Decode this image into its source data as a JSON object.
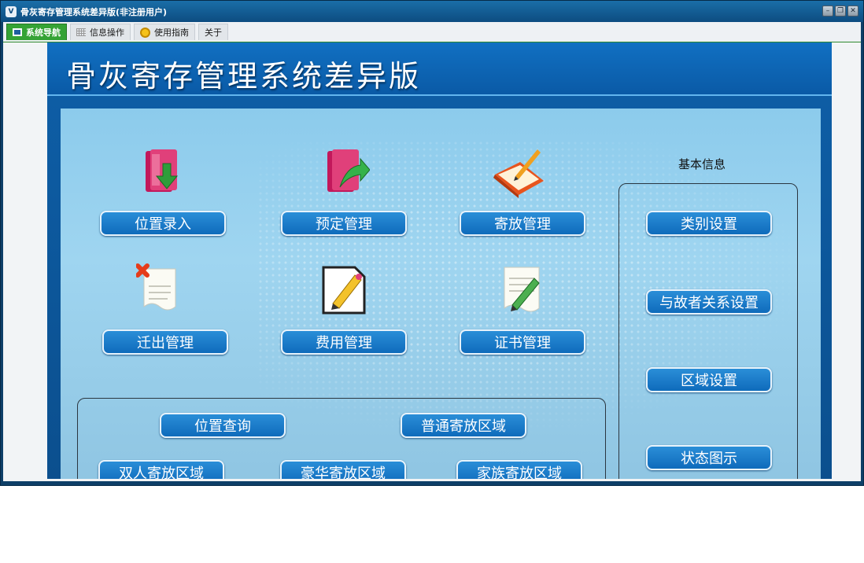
{
  "window": {
    "title": "骨灰寄存管理系统差异版(非注册用户)",
    "icon_text": "V",
    "controls": [
      "minimize-icon",
      "restore-icon",
      "close-icon"
    ]
  },
  "tabs": [
    {
      "label": "系统导航",
      "icon": "monitor-icon",
      "active": true
    },
    {
      "label": "信息操作",
      "icon": "grid-icon",
      "active": false
    },
    {
      "label": "使用指南",
      "icon": "clock-icon",
      "active": false
    },
    {
      "label": "关于",
      "icon": "",
      "active": false
    }
  ],
  "banner": {
    "title": "骨灰寄存管理系统差异版"
  },
  "main": {
    "buttons": {
      "position_entry": "位置录入",
      "reservation": "预定管理",
      "storage": "寄放管理",
      "move_out": "迁出管理",
      "fees": "费用管理",
      "certificate": "证书管理"
    },
    "area": {
      "query": "位置查询",
      "normal": "普通寄放区域",
      "double": "双人寄放区域",
      "luxury": "豪华寄放区域",
      "family": "家族寄放区域"
    }
  },
  "basic_info": {
    "title": "基本信息",
    "category": "类别设置",
    "relation": "与故者关系设置",
    "region": "区域设置",
    "status": "状态图示"
  },
  "colors": {
    "title_bar": "#0d4c80",
    "active_tab": "#35a335",
    "button": "#1a7cc8",
    "panel_bg": "#8ccbec"
  }
}
